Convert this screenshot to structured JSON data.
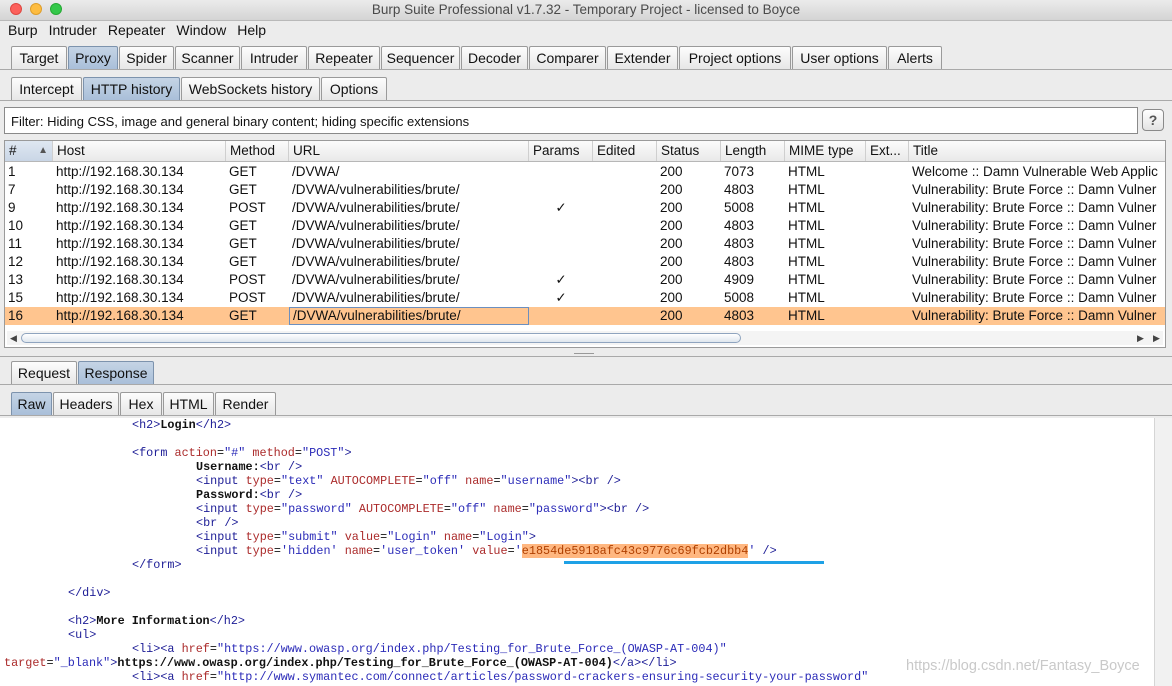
{
  "window": {
    "title": "Burp Suite Professional v1.7.32 - Temporary Project - licensed to Boyce"
  },
  "menu": [
    "Burp",
    "Intruder",
    "Repeater",
    "Window",
    "Help"
  ],
  "main_tabs": [
    "Target",
    "Proxy",
    "Spider",
    "Scanner",
    "Intruder",
    "Repeater",
    "Sequencer",
    "Decoder",
    "Comparer",
    "Extender",
    "Project options",
    "User options",
    "Alerts"
  ],
  "main_tab_selected": "Proxy",
  "proxy_tabs": [
    "Intercept",
    "HTTP history",
    "WebSockets history",
    "Options"
  ],
  "proxy_tab_selected": "HTTP history",
  "filter": {
    "text": "Filter: Hiding CSS, image and general binary content;  hiding specific extensions",
    "help": "?"
  },
  "table": {
    "columns": [
      "#",
      "Host",
      "Method",
      "URL",
      "Params",
      "Edited",
      "Status",
      "Length",
      "MIME type",
      "Ext...",
      "Title"
    ],
    "sort_arrow": "▲",
    "rows": [
      {
        "num": "1",
        "host": "http://192.168.30.134",
        "method": "GET",
        "url": "/DVWA/",
        "params": "",
        "edited": "",
        "status": "200",
        "length": "7073",
        "mime": "HTML",
        "ext": "",
        "title": "Welcome :: Damn Vulnerable Web Applic"
      },
      {
        "num": "7",
        "host": "http://192.168.30.134",
        "method": "GET",
        "url": "/DVWA/vulnerabilities/brute/",
        "params": "",
        "edited": "",
        "status": "200",
        "length": "4803",
        "mime": "HTML",
        "ext": "",
        "title": "Vulnerability: Brute Force :: Damn Vulner"
      },
      {
        "num": "9",
        "host": "http://192.168.30.134",
        "method": "POST",
        "url": "/DVWA/vulnerabilities/brute/",
        "params": "✓",
        "edited": "",
        "status": "200",
        "length": "5008",
        "mime": "HTML",
        "ext": "",
        "title": "Vulnerability: Brute Force :: Damn Vulner"
      },
      {
        "num": "10",
        "host": "http://192.168.30.134",
        "method": "GET",
        "url": "/DVWA/vulnerabilities/brute/",
        "params": "",
        "edited": "",
        "status": "200",
        "length": "4803",
        "mime": "HTML",
        "ext": "",
        "title": "Vulnerability: Brute Force :: Damn Vulner"
      },
      {
        "num": "11",
        "host": "http://192.168.30.134",
        "method": "GET",
        "url": "/DVWA/vulnerabilities/brute/",
        "params": "",
        "edited": "",
        "status": "200",
        "length": "4803",
        "mime": "HTML",
        "ext": "",
        "title": "Vulnerability: Brute Force :: Damn Vulner"
      },
      {
        "num": "12",
        "host": "http://192.168.30.134",
        "method": "GET",
        "url": "/DVWA/vulnerabilities/brute/",
        "params": "",
        "edited": "",
        "status": "200",
        "length": "4803",
        "mime": "HTML",
        "ext": "",
        "title": "Vulnerability: Brute Force :: Damn Vulner"
      },
      {
        "num": "13",
        "host": "http://192.168.30.134",
        "method": "POST",
        "url": "/DVWA/vulnerabilities/brute/",
        "params": "✓",
        "edited": "",
        "status": "200",
        "length": "4909",
        "mime": "HTML",
        "ext": "",
        "title": "Vulnerability: Brute Force :: Damn Vulner"
      },
      {
        "num": "15",
        "host": "http://192.168.30.134",
        "method": "POST",
        "url": "/DVWA/vulnerabilities/brute/",
        "params": "✓",
        "edited": "",
        "status": "200",
        "length": "5008",
        "mime": "HTML",
        "ext": "",
        "title": "Vulnerability: Brute Force :: Damn Vulner"
      },
      {
        "num": "16",
        "host": "http://192.168.30.134",
        "method": "GET",
        "url": "/DVWA/vulnerabilities/brute/",
        "params": "",
        "edited": "",
        "status": "200",
        "length": "4803",
        "mime": "HTML",
        "ext": "",
        "title": "Vulnerability: Brute Force :: Damn Vulner",
        "selected": true
      }
    ]
  },
  "message_tabs": [
    "Request",
    "Response"
  ],
  "message_tab_selected": "Response",
  "view_tabs": [
    "Raw",
    "Headers",
    "Hex",
    "HTML",
    "Render"
  ],
  "view_tab_selected": "Raw",
  "code": {
    "h2_login": "Login",
    "form_action": "\"#\"",
    "form_method": "\"POST\"",
    "username_label": "Username:",
    "password_label": "Password:",
    "input_username": {
      "type": "\"text\"",
      "autocomplete": "\"off\"",
      "name": "\"username\""
    },
    "input_password": {
      "type": "\"password\"",
      "autocomplete": "\"off\"",
      "name": "\"password\""
    },
    "input_submit": {
      "type": "\"submit\"",
      "value": "\"Login\"",
      "name": "\"Login\""
    },
    "input_hidden": {
      "type": "'hidden'",
      "name": "'user_token'",
      "value": "e1854de5918afc43c9776c69fcb2dbb4"
    },
    "h2_more": "More Information",
    "link1": "\"https://www.owasp.org/index.php/Testing_for_Brute_Force_(OWASP-AT-004)\"",
    "link1_target": "\"_blank\"",
    "link1_text": "https://www.owasp.org/index.php/Testing_for_Brute_Force_(OWASP-AT-004)",
    "link2": "\"http://www.symantec.com/connect/articles/password-crackers-ensuring-security-your-password\""
  },
  "watermark": "https://blog.csdn.net/Fantasy_Boyce"
}
